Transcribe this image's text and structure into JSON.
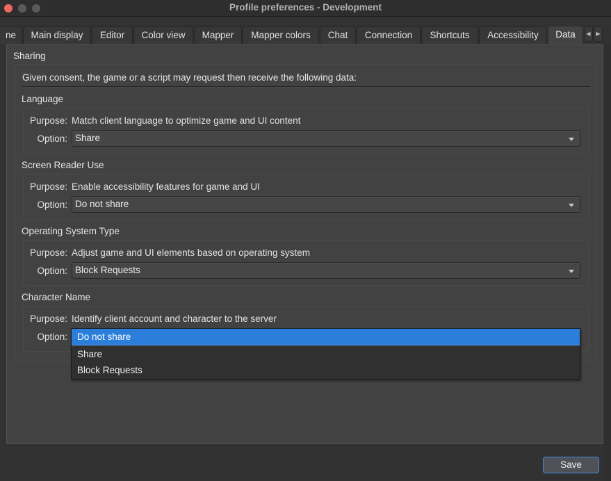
{
  "window": {
    "title": "Profile preferences - Development",
    "controls": [
      "close",
      "minimize",
      "maximize"
    ]
  },
  "tabs": [
    {
      "label": "ne",
      "active": false
    },
    {
      "label": "Main display",
      "active": false
    },
    {
      "label": "Editor",
      "active": false
    },
    {
      "label": "Color view",
      "active": false
    },
    {
      "label": "Mapper",
      "active": false
    },
    {
      "label": "Mapper colors",
      "active": false
    },
    {
      "label": "Chat",
      "active": false
    },
    {
      "label": "Connection",
      "active": false
    },
    {
      "label": "Shortcuts",
      "active": false
    },
    {
      "label": "Accessibility",
      "active": false
    },
    {
      "label": "Data",
      "active": true
    }
  ],
  "tab_scroll": {
    "left_icon": "◀",
    "right_icon": "▶"
  },
  "sharing": {
    "title": "Sharing",
    "intro": "Given consent, the game or a script may request then receive the following data:",
    "purpose_label": "Purpose:",
    "option_label": "Option:",
    "sections": [
      {
        "title": "Language",
        "purpose": "Match client language to optimize game and UI content",
        "option": "Share"
      },
      {
        "title": "Screen Reader Use",
        "purpose": "Enable accessibility features for game and UI",
        "option": "Do not share"
      },
      {
        "title": "Operating System Type",
        "purpose": "Adjust game and UI elements based on operating system",
        "option": "Block Requests"
      },
      {
        "title": "Character Name",
        "purpose": "Identify client account and character to the server",
        "option": "Do not share"
      }
    ]
  },
  "dropdown": {
    "open_for": "Character Name",
    "options": [
      "Do not share",
      "Share",
      "Block Requests"
    ],
    "highlighted": "Do not share"
  },
  "colors": {
    "highlight": "#2b7fdb",
    "focus_border": "#3f8ae0",
    "close": "#ed6a5e"
  },
  "footer": {
    "save_label": "Save"
  }
}
